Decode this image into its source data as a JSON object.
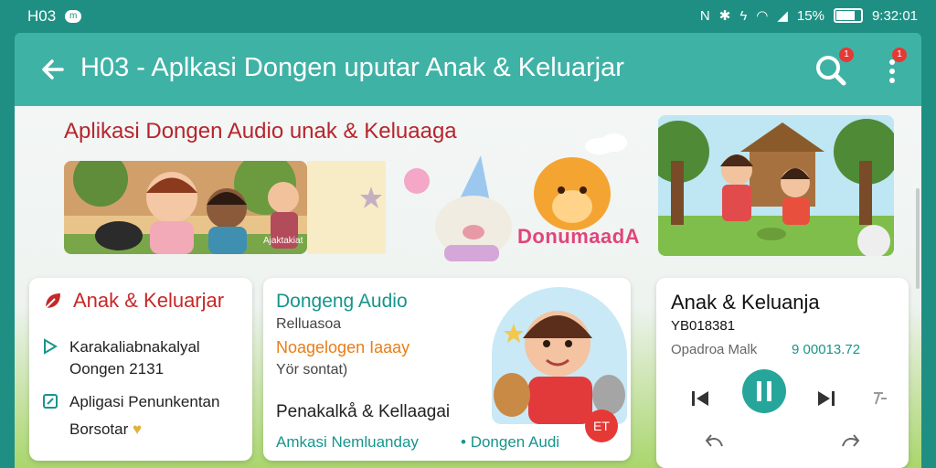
{
  "status_bar": {
    "carrier": "H03",
    "notification": "m",
    "battery_text": "15%",
    "time": "9:32:01"
  },
  "app_bar": {
    "title": "H03 - Aplkasi Dongen uputar Anak & Keluarjar",
    "search_badge": "1",
    "more_badge": "1"
  },
  "hero": {
    "title": "Aplikasi Dongen Audio unak & Keluaaga",
    "brand": "DonumaadA",
    "image_caption": "Ajaktakiat"
  },
  "card_family": {
    "title": "Anak & Keluarjar",
    "item1_title": "Karakaliabnakalyal",
    "item1_sub": "Oongen 2131",
    "item2_title": "Apligasi Penunkentan",
    "item2_sub": "Borsotar"
  },
  "card_audio": {
    "title": "Dongeng Audio",
    "line1": "Relluasoa",
    "line2": "Noagelogen Iaaay",
    "line3": "Yör sontat)",
    "line4": "Penakalkå & Kellaagai",
    "link1": "Amkasi Nemluanday",
    "link2": "Dongen Audi",
    "play_label": "ET"
  },
  "card_player": {
    "title": "Anak & Keluanja",
    "subtitle": "YB018381",
    "meta": "Opadroa Malk",
    "time": "9 00013.72"
  },
  "colors": {
    "teal": "#3fb2a6",
    "dark_teal": "#1f8f84",
    "accent_red": "#c62828",
    "orange": "#e87d18"
  }
}
